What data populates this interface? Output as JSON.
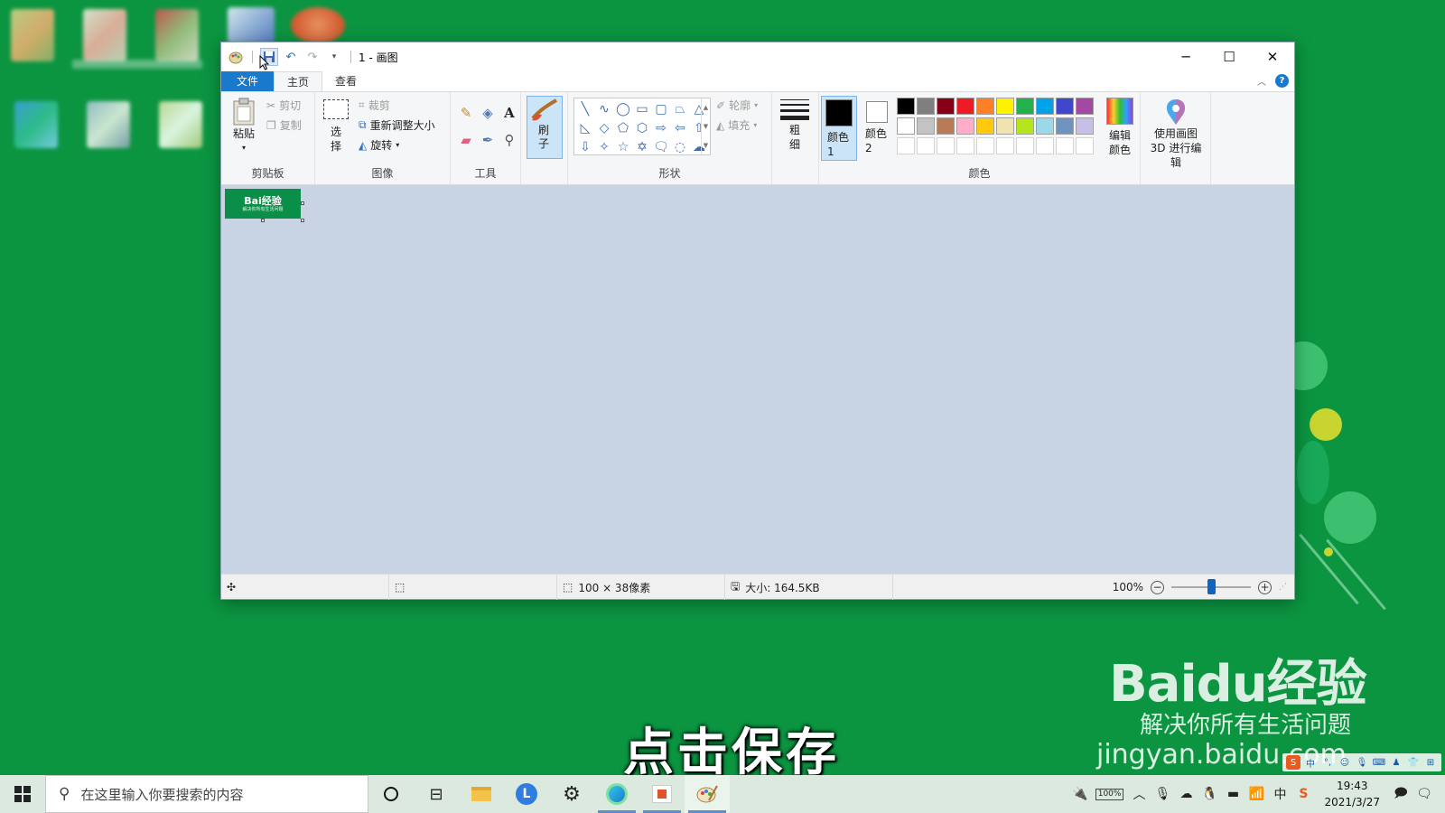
{
  "window": {
    "title": "1 - 画图",
    "controls": {
      "minimize": "─",
      "maximize": "☐",
      "close": "✕"
    }
  },
  "tabs": [
    "文件",
    "主页",
    "查看"
  ],
  "ribbon": {
    "clipboard": {
      "paste": "粘贴",
      "cut": "剪切",
      "copy": "复制",
      "label": "剪贴板"
    },
    "image": {
      "select": "选择",
      "crop": "裁剪",
      "resize": "重新调整大小",
      "rotate": "旋转",
      "label": "图像"
    },
    "tools": {
      "label": "工具"
    },
    "brush": {
      "label": "刷子"
    },
    "shapes": {
      "outline": "轮廓",
      "fill": "填充",
      "label": "形状"
    },
    "size": {
      "label": "粗细"
    },
    "colors": {
      "color1": "颜色 1",
      "color2": "颜色 2",
      "edit": "编辑颜色",
      "paint3d": "使用画图 3D 进行编辑",
      "label": "颜色",
      "color1_value": "#000000",
      "color2_value": "#ffffff",
      "palette": [
        "#000000",
        "#7f7f7f",
        "#880015",
        "#ed1c24",
        "#ff7f27",
        "#fff200",
        "#22b14c",
        "#00a2e8",
        "#3f48cc",
        "#a349a4",
        "#ffffff",
        "#c3c3c3",
        "#b97a57",
        "#ffaec9",
        "#ffc90e",
        "#efe4b0",
        "#b5e61d",
        "#99d9ea",
        "#7092be",
        "#c8bfe7",
        "#ffffff",
        "#ffffff",
        "#ffffff",
        "#ffffff",
        "#ffffff",
        "#ffffff",
        "#ffffff",
        "#ffffff",
        "#ffffff",
        "#ffffff"
      ]
    }
  },
  "canvas": {
    "logo": "Bai经验",
    "sub": "解决你所有生活问题"
  },
  "status": {
    "dimensions": "100 × 38像素",
    "size": "大小: 164.5KB",
    "zoom": "100%"
  },
  "overlay": {
    "subtitle": "点击保存",
    "watermark_main": "Baidu经验",
    "watermark_sub": "解决你所有生活问题",
    "watermark_url": "jingyan.baidu.com"
  },
  "taskbar": {
    "search_placeholder": "在这里输入你要搜索的内容",
    "battery": "100%",
    "time": "19:43",
    "date": "2021/3/27"
  }
}
